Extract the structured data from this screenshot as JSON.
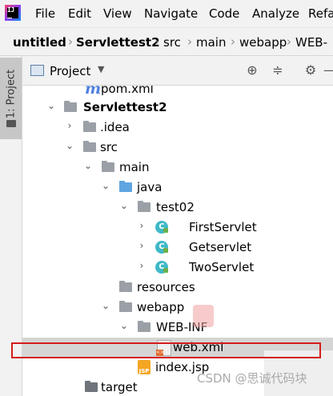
{
  "menubar": {
    "logo_text": "IJ",
    "items": [
      "File",
      "Edit",
      "View",
      "Navigate",
      "Code",
      "Analyze",
      "Refa"
    ]
  },
  "breadcrumb": {
    "items": [
      "untitled",
      "Servlettest2",
      "src",
      "main",
      "webapp",
      "WEB-"
    ]
  },
  "left_strip": {
    "tab_label": "1: Project"
  },
  "project_panel": {
    "title": "Project",
    "dropdown_icon": "chevron-down-icon"
  },
  "tree": {
    "rows": [
      {
        "label": "pom.xml",
        "icon": "maven-icon"
      },
      {
        "label": "Servlettest2",
        "icon": "module-folder-icon"
      },
      {
        "label": ".idea",
        "icon": "folder-icon"
      },
      {
        "label": "src",
        "icon": "folder-icon"
      },
      {
        "label": "main",
        "icon": "folder-icon"
      },
      {
        "label": "java",
        "icon": "source-folder-icon"
      },
      {
        "label": "test02",
        "icon": "package-icon"
      },
      {
        "label": "FirstServlet",
        "icon": "class-icon"
      },
      {
        "label": "Getservlet",
        "icon": "class-icon"
      },
      {
        "label": "TwoServlet",
        "icon": "class-icon"
      },
      {
        "label": "resources",
        "icon": "resources-folder-icon"
      },
      {
        "label": "webapp",
        "icon": "web-folder-icon"
      },
      {
        "label": "WEB-INF",
        "icon": "folder-icon"
      },
      {
        "label": "web.xml",
        "icon": "xml-file-icon"
      },
      {
        "label": "index.jsp",
        "icon": "jsp-file-icon"
      },
      {
        "label": "target",
        "icon": "folder-icon"
      }
    ]
  },
  "watermark": "CSDN @思诚代码块",
  "colors": {
    "selection": "#d5d5d5",
    "highlight_border": "#d41c1c",
    "class_icon": "#3fb9c8"
  }
}
